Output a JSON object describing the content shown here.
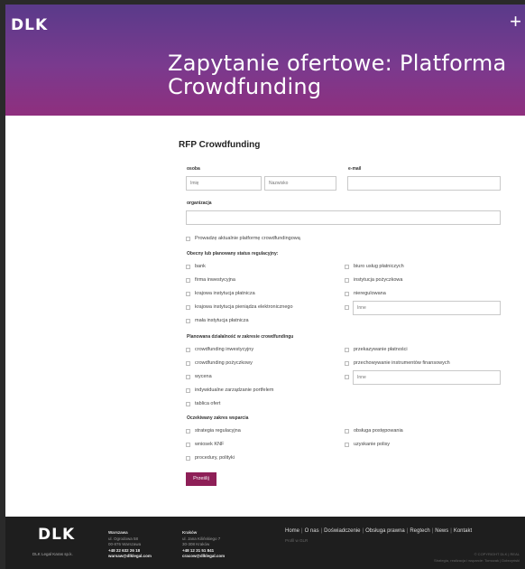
{
  "header": {
    "logo": "DLK",
    "menu_icon": "plus-icon",
    "title": "Zapytanie ofertowe: Platforma Crowdfunding"
  },
  "form": {
    "title": "RFP Crowdfunding",
    "osoba_label": "osoba",
    "imie_placeholder": "Imię",
    "nazwisko_placeholder": "Nazwisko",
    "email_label": "e-mail",
    "organizacja_label": "organizacja",
    "prowadze_label": "Prowadzę aktualnie platformę crowdfundingową",
    "status_section": "Obecny lub planowany status regulacyjny:",
    "status_options_left": [
      "bank",
      "firma inwestycyjna",
      "krajowa instytucja płatnicza",
      "krajowa instytucja pieniądza elektronicznego",
      "mała instytucja płatnicza"
    ],
    "status_options_right": [
      "biuro usług płatniczych",
      "instytucja pożyczkowa",
      "nieregulowana"
    ],
    "status_other_placeholder": "Inne",
    "activity_section": "Planowana działalność w zakresie crowdfundingu",
    "activity_options_left": [
      "crowdfunding inwestycyjny",
      "crowdfunding pożyczkowy",
      "wycena",
      "indywidualne zarządzanie portfelem",
      "tablica ofert"
    ],
    "activity_options_right": [
      "przekazywanie płatności",
      "przechowywanie instrumentów finansowych"
    ],
    "activity_other_placeholder": "Inne",
    "support_section": "Oczekiwany zakres wsparcia",
    "support_options_left": [
      "strategia regulacyjna",
      "wniosek KNF",
      "procedury, polityki"
    ],
    "support_options_right": [
      "obsługa postępowania",
      "uzyskanie polisy"
    ],
    "submit_label": "Prześlij"
  },
  "footer": {
    "logo": "DLK",
    "company": "DLK Legal Karas sp.k.",
    "offices": [
      {
        "name": "Warszawa",
        "address1": "ul. Ogrodowa 58",
        "address2": "00-876 Warszawa",
        "phone": "+48 22 632 26 18",
        "email": "warsaw@dlklegal.com"
      },
      {
        "name": "Kraków",
        "address1": "ul. Jana Kilińskiego 7",
        "address2": "30-308 Kraków",
        "phone": "+48 12 31 51 841",
        "email": "cracow@dlklegal.com"
      }
    ],
    "nav": [
      "Home",
      "O nas",
      "Doświadczenie",
      "Obsługa prawna",
      "Regtech",
      "News",
      "Kontakt"
    ],
    "nav_separator": "|",
    "profile": "Profil w GLR",
    "copyright": "© COPYRIGHT DLK | REAL",
    "credits": "Strategia, realizacja i wsparcie: Tomczak | Dobrzyński"
  }
}
